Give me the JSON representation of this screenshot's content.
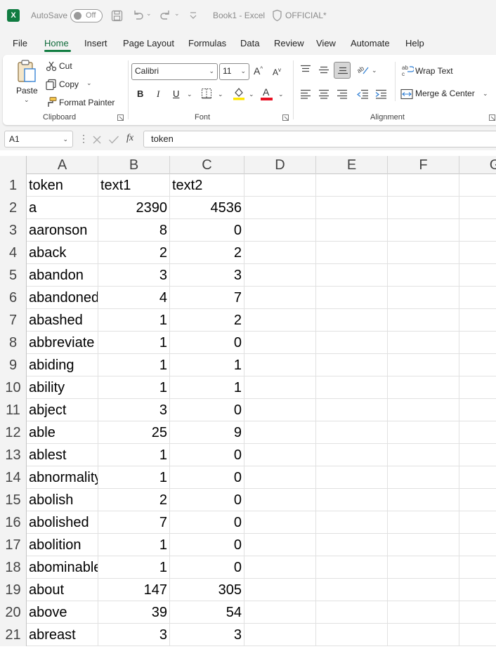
{
  "titlebar": {
    "logo_letter": "X",
    "autosave_label": "AutoSave",
    "autosave_state": "Off",
    "document_title": "Book1 - Excel",
    "sensitivity_label": "OFFICIAL*"
  },
  "menu": [
    "File",
    "Home",
    "Insert",
    "Page Layout",
    "Formulas",
    "Data",
    "Review",
    "View",
    "Automate",
    "Help"
  ],
  "ribbon": {
    "clipboard": {
      "paste": "Paste",
      "cut": "Cut",
      "copy": "Copy",
      "format_painter": "Format Painter",
      "group_label": "Clipboard"
    },
    "font": {
      "font_name": "Calibri",
      "font_size": "11",
      "bold": "B",
      "italic": "I",
      "underline": "U",
      "font_color_glyph": "A",
      "group_label": "Font"
    },
    "alignment": {
      "wrap_text": "Wrap Text",
      "merge_center": "Merge & Center",
      "group_label": "Alignment"
    }
  },
  "formula_bar": {
    "name_box": "A1",
    "fx": "fx",
    "value": "token"
  },
  "columns": [
    "A",
    "B",
    "C",
    "D",
    "E",
    "F",
    "G"
  ],
  "rows": [
    {
      "n": "1",
      "a": "token",
      "b": "text1",
      "c": "text2"
    },
    {
      "n": "2",
      "a": "a",
      "b": "2390",
      "c": "4536"
    },
    {
      "n": "3",
      "a": "aaronson",
      "b": "8",
      "c": "0"
    },
    {
      "n": "4",
      "a": "aback",
      "b": "2",
      "c": "2"
    },
    {
      "n": "5",
      "a": "abandon",
      "b": "3",
      "c": "3"
    },
    {
      "n": "6",
      "a": "abandoned",
      "b": "4",
      "c": "7"
    },
    {
      "n": "7",
      "a": "abashed",
      "b": "1",
      "c": "2"
    },
    {
      "n": "8",
      "a": "abbreviate",
      "b": "1",
      "c": "0"
    },
    {
      "n": "9",
      "a": "abiding",
      "b": "1",
      "c": "1"
    },
    {
      "n": "10",
      "a": "ability",
      "b": "1",
      "c": "1"
    },
    {
      "n": "11",
      "a": "abject",
      "b": "3",
      "c": "0"
    },
    {
      "n": "12",
      "a": "able",
      "b": "25",
      "c": "9"
    },
    {
      "n": "13",
      "a": "ablest",
      "b": "1",
      "c": "0"
    },
    {
      "n": "14",
      "a": "abnormality",
      "b": "1",
      "c": "0"
    },
    {
      "n": "15",
      "a": "abolish",
      "b": "2",
      "c": "0"
    },
    {
      "n": "16",
      "a": "abolished",
      "b": "7",
      "c": "0"
    },
    {
      "n": "17",
      "a": "abolition",
      "b": "1",
      "c": "0"
    },
    {
      "n": "18",
      "a": "abominable",
      "b": "1",
      "c": "0"
    },
    {
      "n": "19",
      "a": "about",
      "b": "147",
      "c": "305"
    },
    {
      "n": "20",
      "a": "above",
      "b": "39",
      "c": "54"
    },
    {
      "n": "21",
      "a": "abreast",
      "b": "3",
      "c": "3"
    }
  ],
  "colors": {
    "excel_green": "#107c41",
    "font_color_bar": "#e81123",
    "highlight_bar": "#ffe600"
  }
}
